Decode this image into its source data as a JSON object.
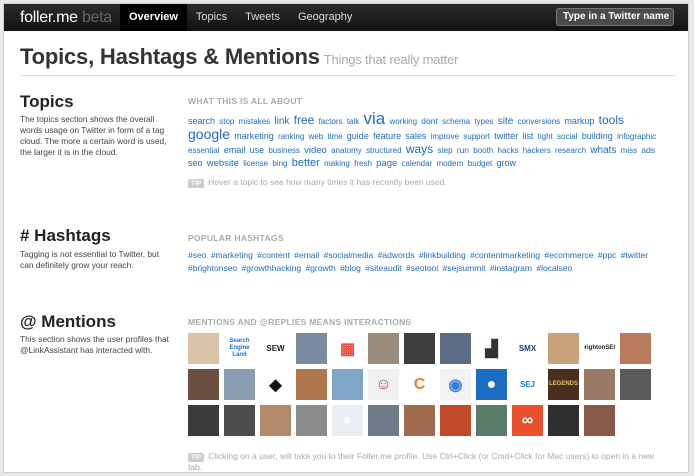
{
  "nav": {
    "brand": "foller.me",
    "brand_suffix": "beta",
    "items": [
      "Overview",
      "Topics",
      "Tweets",
      "Geography"
    ],
    "search_placeholder": "Type in a Twitter name"
  },
  "header": {
    "title": "Topics, Hashtags & Mentions",
    "subtitle": "Things that really matter"
  },
  "topics": {
    "title": "Topics",
    "description": "The topics section shows the overall words usage on Twitter in form of a tag cloud. The more a certain word is used, the larger it is in the cloud.",
    "label": "WHAT THIS IS ALL ABOUT",
    "tags": [
      {
        "t": "search",
        "s": 9
      },
      {
        "t": "stop",
        "s": 8
      },
      {
        "t": "mistakes",
        "s": 8
      },
      {
        "t": "link",
        "s": 10
      },
      {
        "t": "free",
        "s": 12
      },
      {
        "t": "factors",
        "s": 8
      },
      {
        "t": "talk",
        "s": 8
      },
      {
        "t": "via",
        "s": 17
      },
      {
        "t": "working",
        "s": 8
      },
      {
        "t": "dont",
        "s": 8.5
      },
      {
        "t": "schema",
        "s": 8
      },
      {
        "t": "types",
        "s": 8
      },
      {
        "t": "site",
        "s": 10
      },
      {
        "t": "conversions",
        "s": 8
      },
      {
        "t": "markup",
        "s": 9
      },
      {
        "t": "tools",
        "s": 12
      },
      {
        "t": "google",
        "s": 14
      },
      {
        "t": "marketing",
        "s": 9
      },
      {
        "t": "ranking",
        "s": 8
      },
      {
        "t": "web",
        "s": 8
      },
      {
        "t": "time",
        "s": 8
      },
      {
        "t": "guide",
        "s": 9
      },
      {
        "t": "feature",
        "s": 9
      },
      {
        "t": "sales",
        "s": 9
      },
      {
        "t": "improve",
        "s": 8
      },
      {
        "t": "support",
        "s": 8
      },
      {
        "t": "twitter",
        "s": 9
      },
      {
        "t": "list",
        "s": 9
      },
      {
        "t": "tight",
        "s": 8
      },
      {
        "t": "social",
        "s": 8
      },
      {
        "t": "building",
        "s": 9
      },
      {
        "t": "infographic",
        "s": 8
      },
      {
        "t": "essential",
        "s": 8
      },
      {
        "t": "email",
        "s": 9
      },
      {
        "t": "use",
        "s": 9
      },
      {
        "t": "business",
        "s": 8
      },
      {
        "t": "video",
        "s": 9.5
      },
      {
        "t": "anatomy",
        "s": 8
      },
      {
        "t": "structured",
        "s": 8
      },
      {
        "t": "ways",
        "s": 12
      },
      {
        "t": "step",
        "s": 8
      },
      {
        "t": "run",
        "s": 8.5
      },
      {
        "t": "booth",
        "s": 8
      },
      {
        "t": "hacks",
        "s": 8
      },
      {
        "t": "hackers",
        "s": 8
      },
      {
        "t": "research",
        "s": 8
      },
      {
        "t": "whats",
        "s": 10
      },
      {
        "t": "miss",
        "s": 8
      },
      {
        "t": "ads",
        "s": 8.5
      },
      {
        "t": "seo",
        "s": 9
      },
      {
        "t": "website",
        "s": 9.5
      },
      {
        "t": "license",
        "s": 8
      },
      {
        "t": "bing",
        "s": 8
      },
      {
        "t": "better",
        "s": 11
      },
      {
        "t": "making",
        "s": 8
      },
      {
        "t": "fresh",
        "s": 8
      },
      {
        "t": "page",
        "s": 9.5
      },
      {
        "t": "calendar",
        "s": 8
      },
      {
        "t": "modern",
        "s": 8
      },
      {
        "t": "budget",
        "s": 8
      },
      {
        "t": "grow",
        "s": 9
      }
    ],
    "tip_badge": "TIP",
    "tip": "Hover a topic to see how many times it has recently been used."
  },
  "hashtags": {
    "title": "# Hashtags",
    "description": "Tagging is not essential to Twitter, but can definitely grow your reach.",
    "label": "POPULAR HASHTAGS",
    "tags": [
      "#seo",
      "#marketing",
      "#content",
      "#email",
      "#socialmedia",
      "#adwords",
      "#linkbuilding",
      "#contentmarketing",
      "#ecommerce",
      "#ppc",
      "#twitter",
      "#brightonseo",
      "#growthhacking",
      "#growth",
      "#blog",
      "#siteaudit",
      "#seotool",
      "#sejsummit",
      "#instagram",
      "#localseo"
    ]
  },
  "mentions": {
    "title": "@ Mentions",
    "description": "This section shows the user profiles that @LinkAssistant has interacted with.",
    "label": "MENTIONS AND @REPLIES MEANS INTERACTIONS",
    "avatars": [
      {
        "bg": "#d8c2a8",
        "txt": ""
      },
      {
        "bg": "#ffffff",
        "txt": "Search Engine Land",
        "fg": "#1a72c7"
      },
      {
        "bg": "#ffffff",
        "txt": "SEW",
        "fg": "#222"
      },
      {
        "bg": "#7a8aa0",
        "txt": ""
      },
      {
        "bg": "#ffffff",
        "txt": "▦",
        "fg": "#e84c3d"
      },
      {
        "bg": "#9a8c7a",
        "txt": ""
      },
      {
        "bg": "#3d3d3d",
        "txt": ""
      },
      {
        "bg": "#5a6d84",
        "txt": ""
      },
      {
        "bg": "#ffffff",
        "txt": "▟",
        "fg": "#333"
      },
      {
        "bg": "#ffffff",
        "txt": "SMX",
        "fg": "#1a3b8c"
      },
      {
        "bg": "#c9a27a",
        "txt": ""
      },
      {
        "bg": "#ffffff",
        "txt": "brightonSEO",
        "fg": "#222"
      },
      {
        "bg": "#b87a5a",
        "txt": ""
      },
      {
        "bg": "#6a5040",
        "txt": ""
      },
      {
        "bg": "#8a9cb0",
        "txt": ""
      },
      {
        "bg": "#ffffff",
        "txt": "◆",
        "fg": "#111"
      },
      {
        "bg": "#b0764e",
        "txt": ""
      },
      {
        "bg": "#7ea6c8",
        "txt": ""
      },
      {
        "bg": "#f1f1f1",
        "txt": "☺",
        "fg": "#c0392b"
      },
      {
        "bg": "#ffffff",
        "txt": "C",
        "fg": "#f07b1c"
      },
      {
        "bg": "#f3f3f3",
        "txt": "◉",
        "fg": "#3a7bd5"
      },
      {
        "bg": "#1b6dc1",
        "txt": "●",
        "fg": "#ffffff"
      },
      {
        "bg": "#ffffff",
        "txt": "SEJ",
        "fg": "#1a73e8"
      },
      {
        "bg": "#4a2f1e",
        "txt": "LEGENDS",
        "fg": "#e0c070"
      },
      {
        "bg": "#9a7a66",
        "txt": ""
      },
      {
        "bg": "#5b5b5b",
        "txt": ""
      },
      {
        "bg": "#3b3b3b",
        "txt": ""
      },
      {
        "bg": "#4c4c4c",
        "txt": ""
      },
      {
        "bg": "#b08a6a",
        "txt": ""
      },
      {
        "bg": "#8c8c8c",
        "txt": ""
      },
      {
        "bg": "#e9eef4",
        "txt": "●",
        "fg": "#fff"
      },
      {
        "bg": "#6f7a88",
        "txt": ""
      },
      {
        "bg": "#a06a50",
        "txt": ""
      },
      {
        "bg": "#c04a2a",
        "txt": ""
      },
      {
        "bg": "#5a7d6a",
        "txt": ""
      },
      {
        "bg": "#e8502e",
        "txt": "∞",
        "fg": "#fff"
      },
      {
        "bg": "#2f2f2f",
        "txt": ""
      },
      {
        "bg": "#8a5a48",
        "txt": ""
      }
    ],
    "tip_badge": "TIP",
    "tip": "Clicking on a user, will take you to their Foller.me profile. Use Ctrl+Click (or Cmd+Click for Mac users) to open in a new tab."
  }
}
